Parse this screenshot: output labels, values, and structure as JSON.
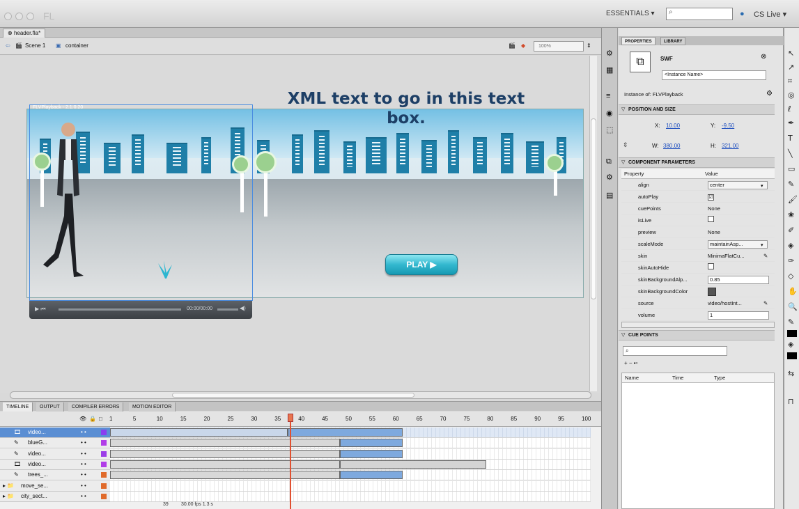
{
  "window": {
    "title": "FL"
  },
  "top_bar": {
    "workspace": "ESSENTIALS ▾",
    "search_placeholder": "⌕",
    "cslive": "CS Live ▾"
  },
  "document": {
    "tab": "header.fla*"
  },
  "edit_bar": {
    "scene": "Scene 1",
    "symbol": "container",
    "zoom": "100%"
  },
  "stage": {
    "headline": "XML text to go in this text box.",
    "play_button": "PLAY ▶",
    "flv_label": "FLVPlayback - 2.1.0.20",
    "skin_time": "00:00/00:00"
  },
  "timeline": {
    "tabs": [
      "TIMELINE",
      "OUTPUT",
      "COMPILER ERRORS",
      "MOTION EDITOR"
    ],
    "header_icons": [
      "👁",
      "🔒",
      "□"
    ],
    "frame_numbers": [
      "1",
      "5",
      "10",
      "15",
      "20",
      "25",
      "30",
      "35",
      "40",
      "45",
      "50",
      "55",
      "60",
      "65",
      "70",
      "75",
      "80",
      "85",
      "90",
      "95",
      "100"
    ],
    "layers": [
      {
        "name": "video...",
        "icon": "video-layer-icon",
        "color": "#8a3df0",
        "selected": true
      },
      {
        "name": "blueG...",
        "icon": "guide-layer-icon",
        "color": "#b13de8",
        "selected": false
      },
      {
        "name": "video...",
        "icon": "guide-layer-icon",
        "color": "#9b3de8",
        "selected": false
      },
      {
        "name": "video...",
        "icon": "video-layer-icon",
        "color": "#b13de8",
        "selected": false
      },
      {
        "name": "trees_...",
        "icon": "guide-layer-icon",
        "color": "#e06a2a",
        "selected": false
      },
      {
        "name": "move_se...",
        "icon": "folder-icon",
        "color": "#e06a2a",
        "selected": false
      },
      {
        "name": "city_sect...",
        "icon": "folder-icon",
        "color": "#e06a2a",
        "selected": false
      }
    ],
    "status": "30.00 fps  1.3 s",
    "current_frame": "39"
  },
  "properties": {
    "tabs": [
      "PROPERTIES",
      "LIBRARY"
    ],
    "type": "SWF",
    "instance_name_placeholder": "<Instance Name>",
    "instance_of": "Instance of:  FLVPlayback",
    "position_section": "POSITION AND SIZE",
    "x_label": "X:",
    "x": "10.00",
    "y_label": "Y:",
    "y": "-9.50",
    "w_label": "W:",
    "w": "380.00",
    "h_label": "H:",
    "h": "321.00",
    "params_section": "COMPONENT PARAMETERS",
    "col_property": "Property",
    "col_value": "Value",
    "params": [
      {
        "name": "align",
        "value": "center",
        "kind": "select"
      },
      {
        "name": "autoPlay",
        "value": "☑",
        "kind": "check"
      },
      {
        "name": "cuePoints",
        "value": "None",
        "kind": "text"
      },
      {
        "name": "isLive",
        "value": "",
        "kind": "check"
      },
      {
        "name": "preview",
        "value": "None",
        "kind": "text"
      },
      {
        "name": "scaleMode",
        "value": "maintainAsp...",
        "kind": "select"
      },
      {
        "name": "skin",
        "value": "MinimaFlatCu...",
        "kind": "text"
      },
      {
        "name": "skinAutoHide",
        "value": "",
        "kind": "check"
      },
      {
        "name": "skinBackgroundAlp...",
        "value": "0.85",
        "kind": "input"
      },
      {
        "name": "skinBackgroundColor",
        "value": "",
        "kind": "swatch"
      },
      {
        "name": "source",
        "value": "video/hostInt...",
        "kind": "text"
      },
      {
        "name": "volume",
        "value": "1",
        "kind": "input"
      }
    ],
    "cue_section": "CUE POINTS",
    "cue_columns": [
      "Name",
      "Time",
      "Type"
    ]
  },
  "colors": {
    "accent": "#5a8ed3",
    "headline": "#1d3f66",
    "play": "#33b8cf"
  }
}
